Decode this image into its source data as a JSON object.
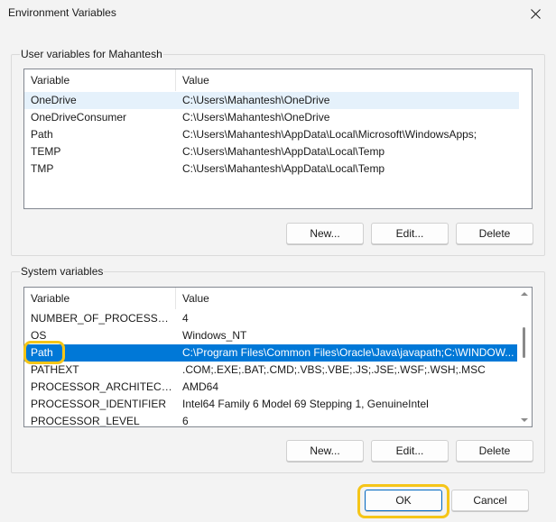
{
  "window": {
    "title": "Environment Variables",
    "close_icon": "close-icon"
  },
  "user_vars": {
    "group_label": "User variables for Mahantesh",
    "columns": [
      "Variable",
      "Value"
    ],
    "rows": [
      {
        "name": "OneDrive",
        "value": "C:\\Users\\Mahantesh\\OneDrive"
      },
      {
        "name": "OneDriveConsumer",
        "value": "C:\\Users\\Mahantesh\\OneDrive"
      },
      {
        "name": "Path",
        "value": "C:\\Users\\Mahantesh\\AppData\\Local\\Microsoft\\WindowsApps;"
      },
      {
        "name": "TEMP",
        "value": "C:\\Users\\Mahantesh\\AppData\\Local\\Temp"
      },
      {
        "name": "TMP",
        "value": "C:\\Users\\Mahantesh\\AppData\\Local\\Temp"
      }
    ],
    "buttons": {
      "new": "New...",
      "edit": "Edit...",
      "delete": "Delete"
    }
  },
  "system_vars": {
    "group_label": "System variables",
    "columns": [
      "Variable",
      "Value"
    ],
    "rows": [
      {
        "name": "NUMBER_OF_PROCESSORS",
        "value": "4"
      },
      {
        "name": "OS",
        "value": "Windows_NT"
      },
      {
        "name": "Path",
        "value": "C:\\Program Files\\Common Files\\Oracle\\Java\\javapath;C:\\WINDOW..."
      },
      {
        "name": "PATHEXT",
        "value": ".COM;.EXE;.BAT;.CMD;.VBS;.VBE;.JS;.JSE;.WSF;.WSH;.MSC"
      },
      {
        "name": "PROCESSOR_ARCHITECTURE",
        "value": "AMD64"
      },
      {
        "name": "PROCESSOR_IDENTIFIER",
        "value": "Intel64 Family 6 Model 69 Stepping 1, GenuineIntel"
      },
      {
        "name": "PROCESSOR_LEVEL",
        "value": "6"
      }
    ],
    "selected_row": "Path",
    "buttons": {
      "new": "New...",
      "edit": "Edit...",
      "delete": "Delete"
    }
  },
  "footer": {
    "ok": "OK",
    "cancel": "Cancel"
  },
  "colors": {
    "selection": "#0078d7",
    "hover_row": "#e5f1fb",
    "annotation_ring": "#f5c518"
  }
}
